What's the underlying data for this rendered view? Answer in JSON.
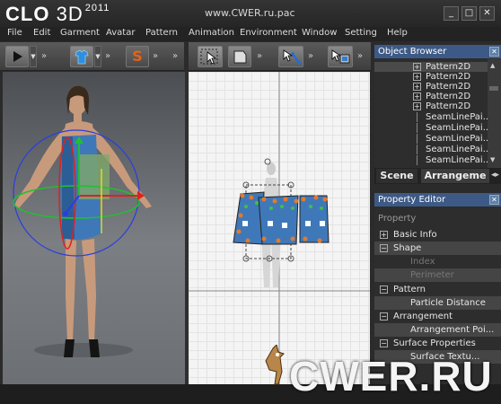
{
  "app": {
    "logo_clo": "CLO",
    "logo_3d": "3D",
    "version": "2011",
    "url": "www.CWER.ru.pac"
  },
  "window_buttons": [
    "_",
    "□",
    "✕"
  ],
  "menu": [
    "File",
    "Edit",
    "Garment",
    "Avatar",
    "Pattern",
    "Animation",
    "Environment",
    "Window",
    "Setting",
    "Help"
  ],
  "toolbar": {
    "s_label": "S",
    "more": "»"
  },
  "object_browser": {
    "title": "Object Browser",
    "items": [
      "Pattern2D",
      "Pattern2D",
      "Pattern2D",
      "Pattern2D",
      "Pattern2D",
      "SeamLinePai...",
      "SeamLinePai...",
      "SeamLinePai...",
      "SeamLinePai...",
      "SeamLinePai..."
    ],
    "tabs": [
      "Scene",
      "Arrangeme"
    ]
  },
  "property_editor": {
    "title": "Property Editor",
    "header": "Property",
    "rows": [
      {
        "label": "Basic Info",
        "type": "group",
        "sign": "+"
      },
      {
        "label": "Shape",
        "type": "group",
        "sign": "−"
      },
      {
        "label": "Index",
        "type": "disabled"
      },
      {
        "label": "Perimeter",
        "type": "disabled"
      },
      {
        "label": "Pattern",
        "type": "group",
        "sign": "−"
      },
      {
        "label": "Particle Distance",
        "type": "child"
      },
      {
        "label": "Arrangement",
        "type": "group",
        "sign": "−"
      },
      {
        "label": "Arrangement Poi...",
        "type": "child"
      },
      {
        "label": "Surface Properties",
        "type": "group",
        "sign": "−"
      },
      {
        "label": "Surface Textu...",
        "type": "child"
      }
    ]
  },
  "watermark": "CWER.RU",
  "colors": {
    "accent_blue": "#3d5a86",
    "dress_blue": "#3f78b8",
    "gizmo_red": "#e02020",
    "gizmo_green": "#20c030",
    "gizmo_blue": "#2a3ee0",
    "s_orange": "#e0641a"
  }
}
